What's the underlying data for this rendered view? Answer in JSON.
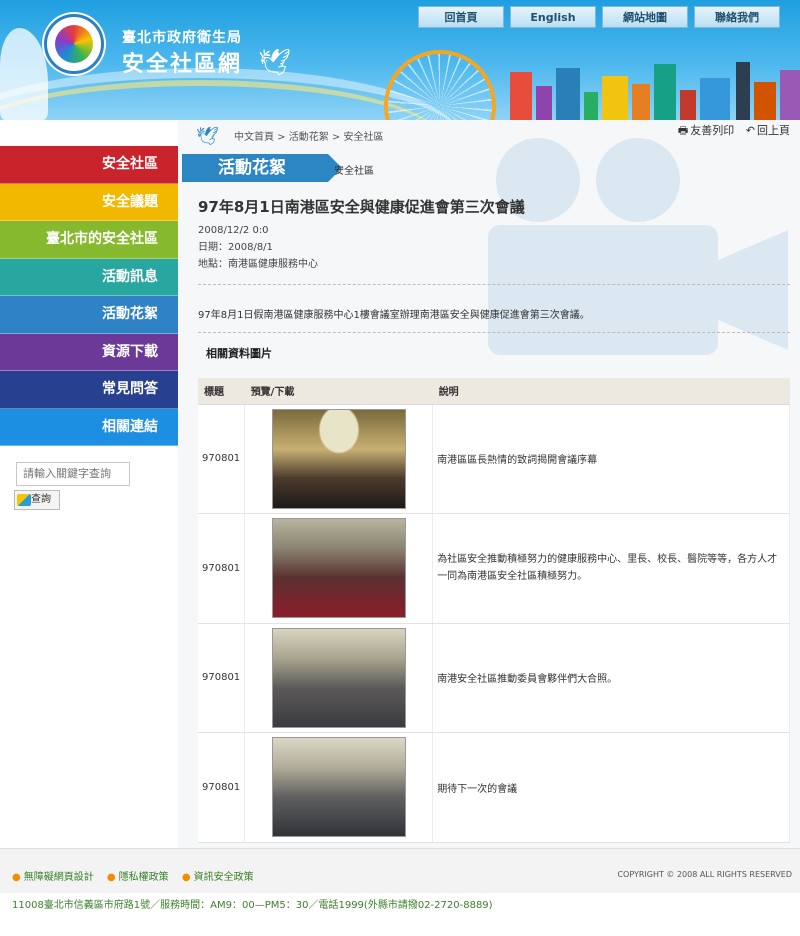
{
  "header": {
    "agency": "臺北市政府衛生局",
    "site_title": "安全社區網",
    "top_nav": [
      "回首頁",
      "English",
      "網站地圖",
      "聯絡我們"
    ]
  },
  "sidebar": {
    "items": [
      {
        "label": "安全社區",
        "color": "#c9242b"
      },
      {
        "label": "安全議題",
        "color": "#f2b800"
      },
      {
        "label": "臺北市的安全社區",
        "color": "#86b92d"
      },
      {
        "label": "活動訊息",
        "color": "#28a6a0"
      },
      {
        "label": "活動花絮",
        "color": "#2f82c6"
      },
      {
        "label": "資源下載",
        "color": "#6b3a98"
      },
      {
        "label": "常見問答",
        "color": "#27408f"
      },
      {
        "label": "相關連結",
        "color": "#1d8fe2"
      }
    ],
    "search_placeholder": "請輸入關鍵字查詢",
    "search_button": "查詢"
  },
  "breadcrumb": "中文首頁 > 活動花絮 > 安全社區",
  "tools": {
    "print": "友善列印",
    "back": "回上頁"
  },
  "section": {
    "title": "活動花絮",
    "subtitle": "安全社區"
  },
  "article": {
    "title": "97年8月1日南港區安全與健康促進會第三次會議",
    "posted": "2008/12/2 0:0",
    "date": "日期：2008/8/1",
    "location": "地點：南港區健康服務中心",
    "body": "97年8月1日假南港區健康服務中心1樓會議室辦理南港區安全與健康促進會第三次會議。"
  },
  "related": {
    "title": "相關資料圖片",
    "columns": [
      "標題",
      "預覽/下載",
      "說明"
    ],
    "rows": [
      {
        "label": "970801",
        "desc": "南港區區長熱情的致詞揭開會議序幕"
      },
      {
        "label": "970801",
        "desc": "為社區安全推動積極努力的健康服務中心、里長、校長、醫院等等，各方人才一同為南港區安全社區積極努力。"
      },
      {
        "label": "970801",
        "desc": "南港安全社區推動委員會夥伴們大合照。"
      },
      {
        "label": "970801",
        "desc": "期待下一次的會議"
      }
    ]
  },
  "footer": {
    "links": [
      "無障礙網頁設計",
      "隱私權政策",
      "資訊安全政策"
    ],
    "copyright": "COPYRIGHT © 2008 ALL RIGHTS RESERVED",
    "address": "11008臺北市信義區市府路1號／服務時間：AM9：00—PM5：30／電話1999(外縣市請撥02-2720-8889)"
  }
}
